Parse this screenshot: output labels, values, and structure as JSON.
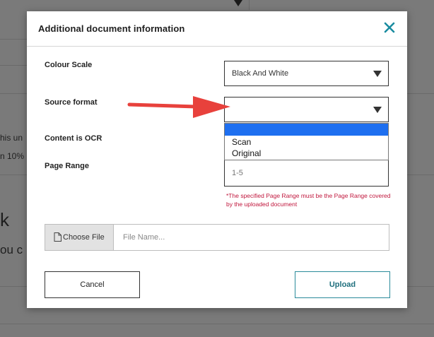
{
  "background": {
    "fragment_1": "his un",
    "fragment_2": "n 10%",
    "fragment_3": "k",
    "fragment_4": "ou c"
  },
  "modal": {
    "title": "Additional document information",
    "close_icon": "close-icon",
    "fields": {
      "colour_scale": {
        "label": "Colour Scale",
        "value": "Black And White"
      },
      "source_format": {
        "label": "Source format",
        "value": "",
        "options": [
          "Scan",
          "Original"
        ]
      },
      "content_ocr": {
        "label": "Content is OCR"
      },
      "page_range": {
        "label": "Page Range",
        "placeholder": "1-5",
        "note": "*The specified Page Range must be the Page Range covered by the uploaded document"
      }
    },
    "file": {
      "button_label": "Choose File",
      "placeholder": "File Name..."
    },
    "buttons": {
      "cancel": "Cancel",
      "upload": "Upload"
    }
  },
  "colors": {
    "accent": "#1f6f7d",
    "close": "#1a8ca0",
    "note": "#c0163c",
    "highlight": "#1e6ff0",
    "arrow": "#e8413c"
  }
}
